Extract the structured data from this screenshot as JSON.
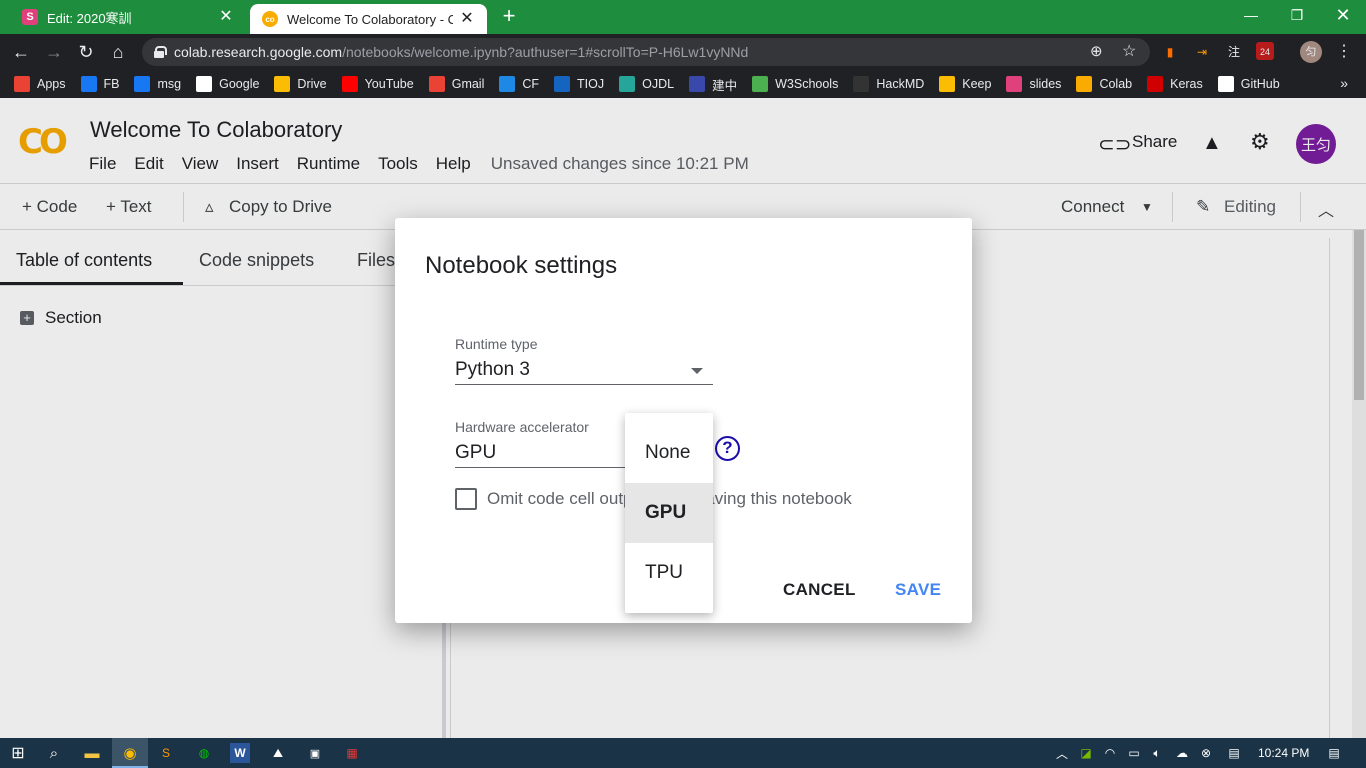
{
  "browser": {
    "tabs": [
      {
        "title": "Edit: 2020寒訓",
        "favicon_letter": "S",
        "favicon_color": "#e0407b"
      },
      {
        "title": "Welcome To Colaboratory - Cola",
        "favicon_letter": "co",
        "favicon_color": "#f9ab00"
      }
    ],
    "new_tab": "+",
    "address": {
      "host": "colab.research.google.com",
      "path": "/notebooks/welcome.ipynb?authuser=1#scrollTo=P-H6Lw1vyNNd"
    },
    "extensions": {
      "badge": "24",
      "profile": "匀",
      "ext_char": "注"
    },
    "bookmarks": [
      {
        "label": "Apps",
        "color": "#ea4335"
      },
      {
        "label": "FB",
        "color": "#1877f2"
      },
      {
        "label": "msg",
        "color": "#1877f2"
      },
      {
        "label": "Google",
        "color": "#ffffff"
      },
      {
        "label": "Drive",
        "color": "#fbbc04"
      },
      {
        "label": "YouTube",
        "color": "#ff0000"
      },
      {
        "label": "Gmail",
        "color": "#ea4335"
      },
      {
        "label": "CF",
        "color": "#1e88e5"
      },
      {
        "label": "TIOJ",
        "color": "#1565c0"
      },
      {
        "label": "OJDL",
        "color": "#26a69a"
      },
      {
        "label": "建中",
        "color": "#3949ab"
      },
      {
        "label": "W3Schools",
        "color": "#4caf50"
      },
      {
        "label": "HackMD",
        "color": "#333333"
      },
      {
        "label": "Keep",
        "color": "#fbbc04"
      },
      {
        "label": "slides",
        "color": "#e0407b"
      },
      {
        "label": "Colab",
        "color": "#f9ab00"
      },
      {
        "label": "Keras",
        "color": "#d00000"
      },
      {
        "label": "GitHub",
        "color": "#ffffff"
      }
    ],
    "more": "»"
  },
  "colab": {
    "logo": "CO",
    "title": "Welcome To Colaboratory",
    "menu": [
      "File",
      "Edit",
      "View",
      "Insert",
      "Runtime",
      "Tools",
      "Help"
    ],
    "unsaved": "Unsaved changes since 10:21 PM",
    "share": "Share",
    "avatar": "王匀",
    "toolbar": {
      "code": "+ Code",
      "text": "+ Text",
      "copy": "Copy to Drive",
      "connect": "Connect",
      "editing": "Editing"
    },
    "sidebar": {
      "tabs": [
        "Table of contents",
        "Code snippets",
        "Files"
      ],
      "section": "Section"
    }
  },
  "dialog": {
    "title": "Notebook settings",
    "runtime_label": "Runtime type",
    "runtime_value": "Python 3",
    "accel_label": "Hardware accelerator",
    "accel_value": "GPU",
    "omit_label": "Omit code cell output when saving this notebook",
    "help": "?",
    "cancel": "CANCEL",
    "save": "SAVE",
    "options": [
      "None",
      "GPU",
      "TPU"
    ],
    "selected_option": "GPU"
  },
  "taskbar": {
    "time": "10:24 PM"
  }
}
